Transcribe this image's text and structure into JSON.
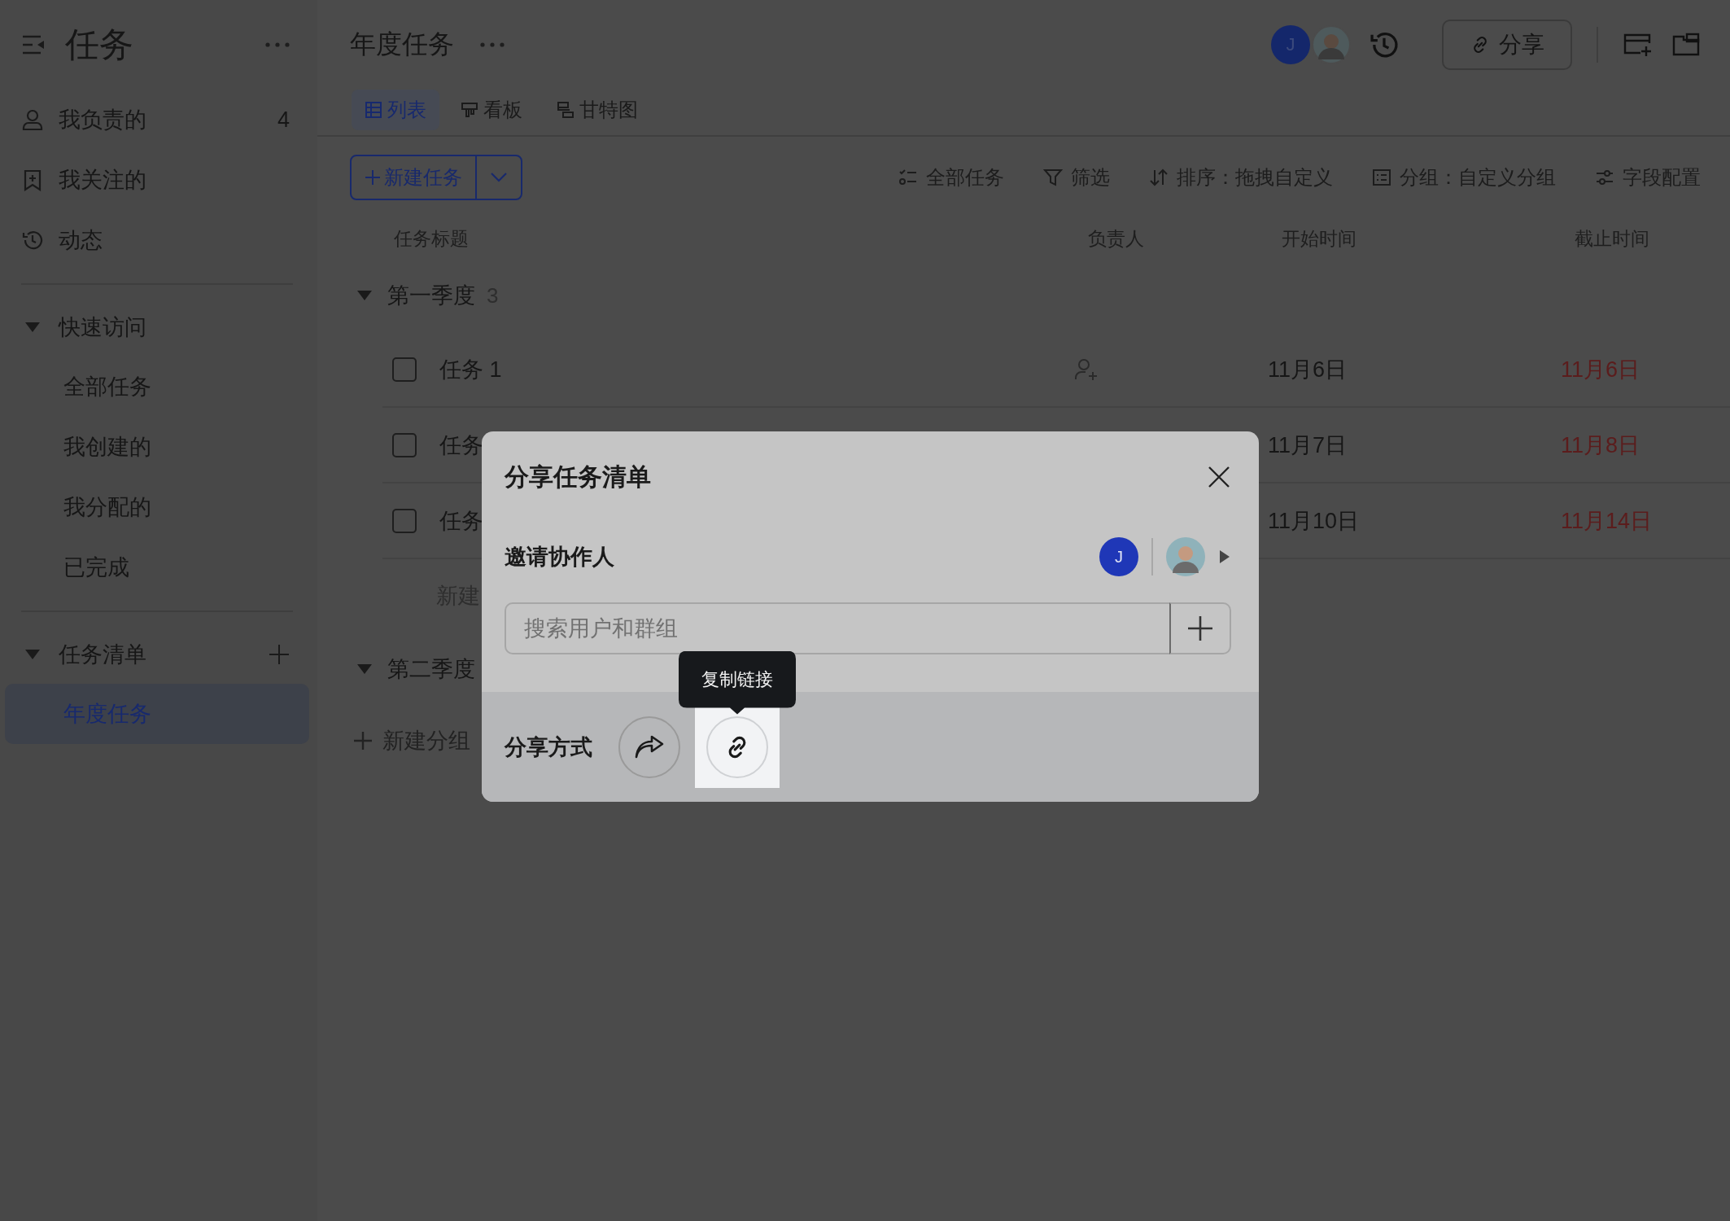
{
  "sidebar": {
    "title": "任务",
    "items": [
      {
        "kind": "person",
        "label": "我负责的",
        "count": "4"
      },
      {
        "kind": "bookmark",
        "label": "我关注的"
      },
      {
        "kind": "history",
        "label": "动态"
      }
    ],
    "sections": [
      {
        "title": "快速访问",
        "expanded": true,
        "items": [
          {
            "label": "全部任务",
            "selected": false
          },
          {
            "label": "我创建的",
            "selected": false
          },
          {
            "label": "我分配的",
            "selected": false
          },
          {
            "label": "已完成",
            "selected": false
          }
        ]
      },
      {
        "title": "任务清单",
        "expanded": true,
        "addable": true,
        "items": [
          {
            "label": "年度任务",
            "selected": true
          }
        ]
      }
    ]
  },
  "header": {
    "title": "年度任务",
    "avatars": [
      {
        "kind": "initial",
        "text": "J"
      },
      {
        "kind": "photo"
      }
    ],
    "share_button": "分享"
  },
  "tabs": [
    {
      "kind": "list",
      "label": "列表",
      "selected": true
    },
    {
      "kind": "board",
      "label": "看板",
      "selected": false
    },
    {
      "kind": "gantt",
      "label": "甘特图",
      "selected": false
    }
  ],
  "new_task_button": "新建任务",
  "toolbar": [
    {
      "kind": "tasks",
      "label": "全部任务"
    },
    {
      "kind": "filter",
      "label": "筛选"
    },
    {
      "kind": "sort",
      "label": "排序：拖拽自定义"
    },
    {
      "kind": "group",
      "label": "分组：自定义分组"
    },
    {
      "kind": "fields",
      "label": "字段配置"
    }
  ],
  "table": {
    "columns": [
      "任务标题",
      "负责人",
      "开始时间",
      "截止时间"
    ],
    "groups": [
      {
        "title": "第一季度",
        "count": "3",
        "expanded": true,
        "add_label": "新建",
        "rows": [
          {
            "title": "任务 1",
            "checked": false,
            "assignee_empty": true,
            "start": "11月6日",
            "due": "11月6日",
            "overdue": true
          },
          {
            "title": "任务",
            "checked": false,
            "start": "11月7日",
            "due": "11月8日",
            "overdue": true
          },
          {
            "title": "任务",
            "checked": false,
            "start": "11月10日",
            "due": "11月14日",
            "overdue": true
          }
        ]
      },
      {
        "title": "第二季度",
        "expanded": true
      }
    ],
    "add_group": "新建分组"
  },
  "dialog": {
    "title": "分享任务清单",
    "invite_label": "邀请协作人",
    "collaborators": [
      {
        "kind": "initial",
        "text": "J"
      },
      {
        "kind": "photo"
      }
    ],
    "search": {
      "placeholder": "搜索用户和群组"
    },
    "share_label": "分享方式",
    "share_buttons": [
      {
        "kind": "forward",
        "highlighted": false
      },
      {
        "kind": "link",
        "highlighted": true
      }
    ],
    "tooltip": "复制链接"
  }
}
